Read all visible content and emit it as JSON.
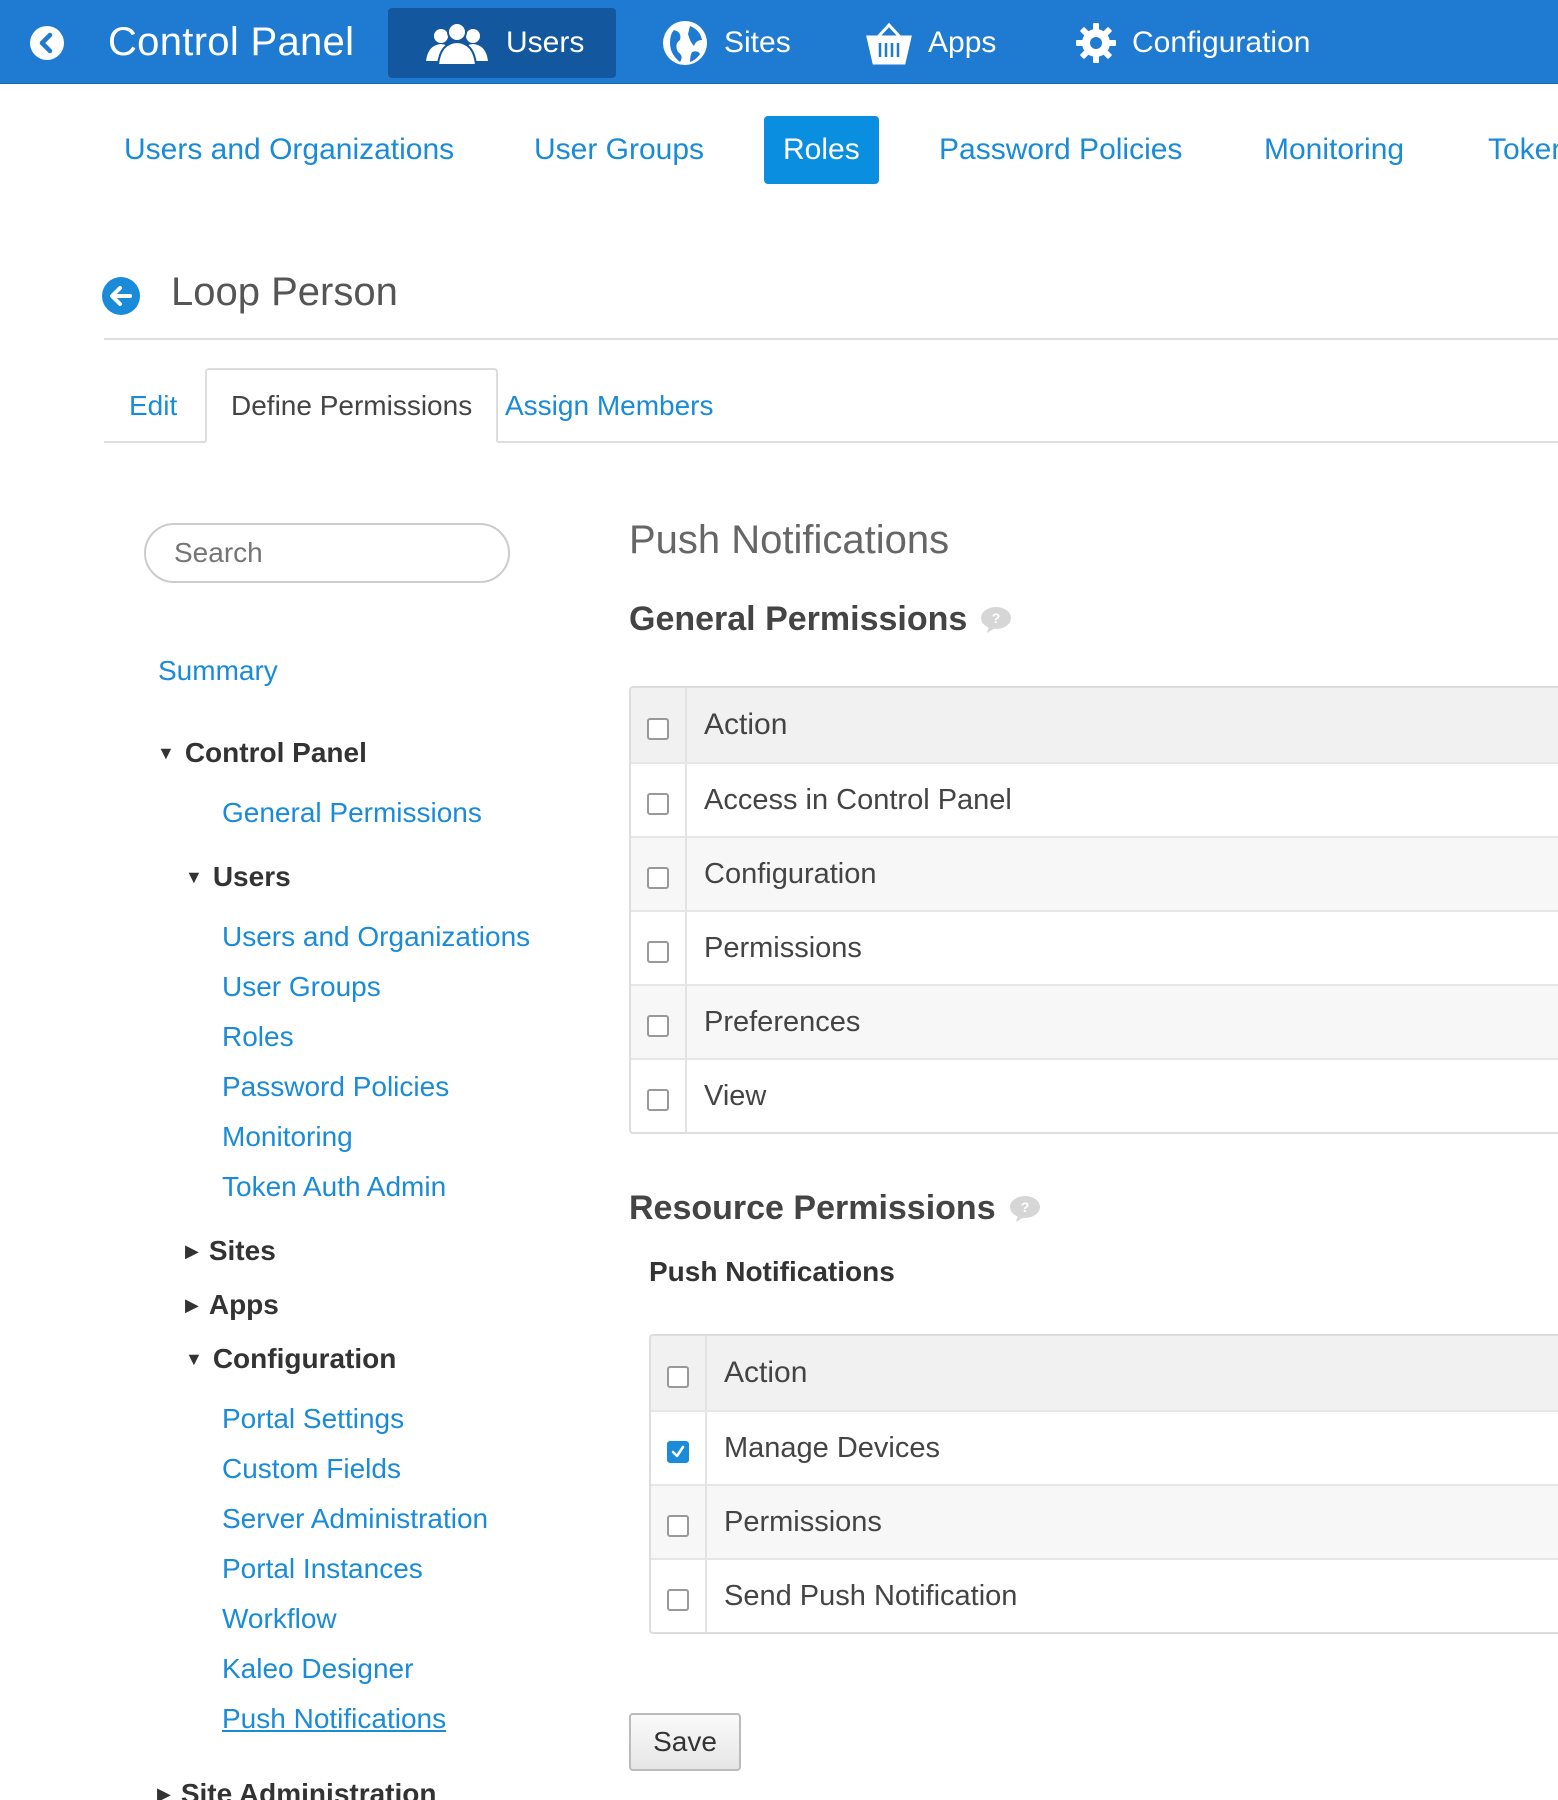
{
  "topbar": {
    "title": "Control Panel",
    "nav": [
      {
        "label": "Users",
        "icon": "users-icon"
      },
      {
        "label": "Sites",
        "icon": "globe-icon"
      },
      {
        "label": "Apps",
        "icon": "basket-icon"
      },
      {
        "label": "Configuration",
        "icon": "gear-icon"
      }
    ],
    "active": "Users",
    "color": "#1f7ad1"
  },
  "subnav": [
    "Users and Organizations",
    "User Groups",
    "Roles",
    "Password Policies",
    "Monitoring",
    "Token"
  ],
  "subnav_active": "Roles",
  "page": {
    "title": "Loop Person",
    "tabs": [
      "Edit",
      "Define Permissions",
      "Assign Members"
    ],
    "active_tab": "Define Permissions"
  },
  "sidebar": {
    "search_placeholder": "Search",
    "summary": "Summary",
    "control_panel": "Control Panel",
    "general_permissions": "General Permissions",
    "users": {
      "label": "Users",
      "items": [
        "Users and Organizations",
        "User Groups",
        "Roles",
        "Password Policies",
        "Monitoring",
        "Token Auth Admin"
      ]
    },
    "sites": "Sites",
    "apps": "Apps",
    "configuration": {
      "label": "Configuration",
      "items": [
        "Portal Settings",
        "Custom Fields",
        "Server Administration",
        "Portal Instances",
        "Workflow",
        "Kaleo Designer",
        "Push Notifications"
      ]
    },
    "site_administration": "Site Administration"
  },
  "content": {
    "section_title": "Push Notifications",
    "general": {
      "heading": "General Permissions",
      "header": "Action",
      "rows": [
        {
          "label": "Access in Control Panel",
          "checked": false
        },
        {
          "label": "Configuration",
          "checked": false
        },
        {
          "label": "Permissions",
          "checked": false
        },
        {
          "label": "Preferences",
          "checked": false
        },
        {
          "label": "View",
          "checked": false
        }
      ]
    },
    "resource": {
      "heading": "Resource Permissions",
      "subheading": "Push Notifications",
      "header": "Action",
      "rows": [
        {
          "label": "Manage Devices",
          "checked": true
        },
        {
          "label": "Permissions",
          "checked": false
        },
        {
          "label": "Send Push Notification",
          "checked": false
        }
      ]
    },
    "save_label": "Save"
  },
  "colors": {
    "accent": "#1a8bd8",
    "topbar": "#1f7ad1",
    "active_nav": "#13579e"
  }
}
